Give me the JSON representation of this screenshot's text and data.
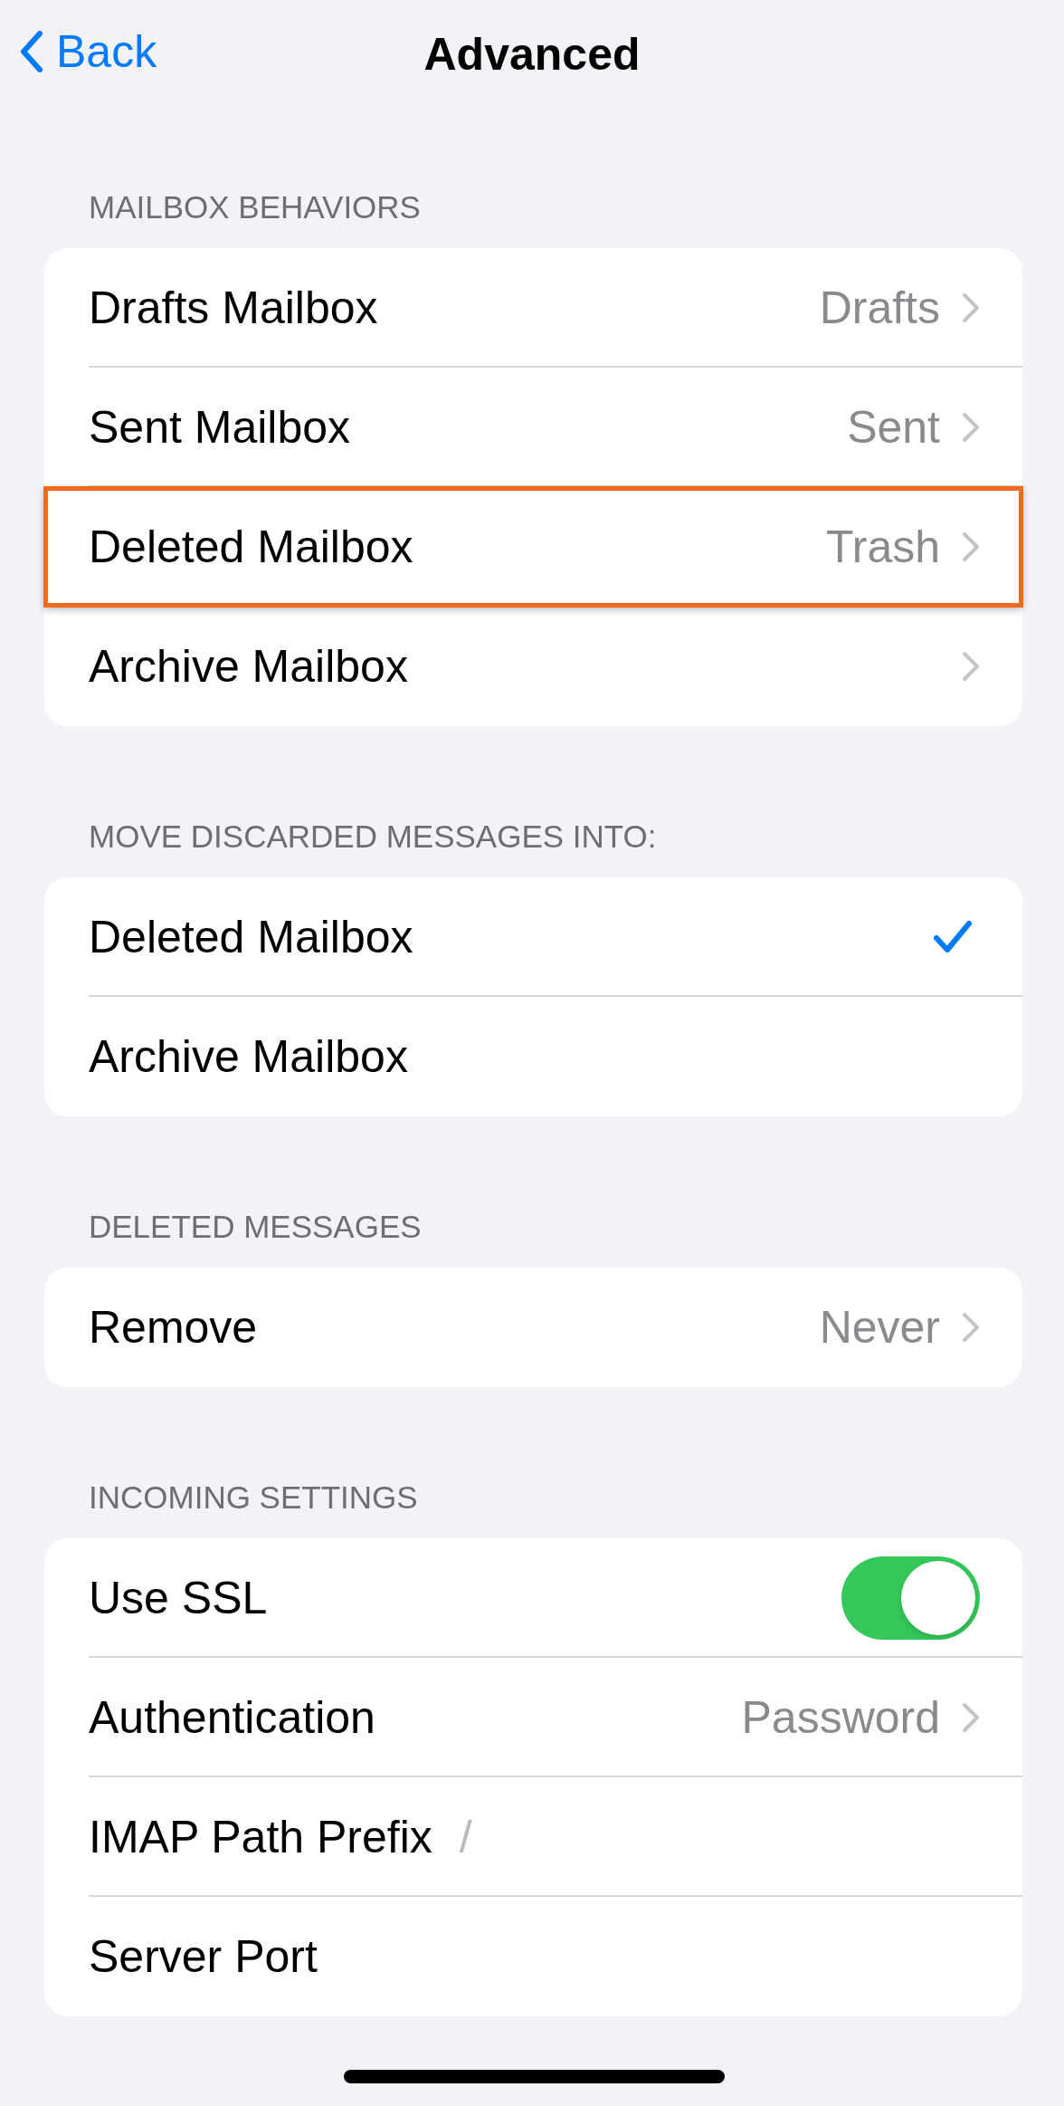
{
  "nav": {
    "back": "Back",
    "title": "Advanced"
  },
  "sections": [
    {
      "header": "MAILBOX BEHAVIORS",
      "rows": [
        {
          "kind": "link",
          "label": "Drafts Mailbox",
          "value": "Drafts",
          "highlighted": false
        },
        {
          "kind": "link",
          "label": "Sent Mailbox",
          "value": "Sent",
          "highlighted": false
        },
        {
          "kind": "link",
          "label": "Deleted Mailbox",
          "value": "Trash",
          "highlighted": true
        },
        {
          "kind": "link",
          "label": "Archive Mailbox",
          "highlighted": false
        }
      ]
    },
    {
      "header": "MOVE DISCARDED MESSAGES INTO:",
      "rows": [
        {
          "kind": "check",
          "label": "Deleted Mailbox",
          "selected": true
        },
        {
          "kind": "check",
          "label": "Archive Mailbox",
          "selected": false
        }
      ]
    },
    {
      "header": "DELETED MESSAGES",
      "rows": [
        {
          "kind": "link",
          "label": "Remove",
          "value": "Never",
          "highlighted": false
        }
      ]
    },
    {
      "header": "INCOMING SETTINGS",
      "rows": [
        {
          "kind": "toggle",
          "label": "Use SSL",
          "on": true
        },
        {
          "kind": "link",
          "label": "Authentication",
          "value": "Password",
          "highlighted": false
        },
        {
          "kind": "field",
          "label": "IMAP Path Prefix",
          "placeholder": "/"
        },
        {
          "kind": "field",
          "label": "Server Port"
        }
      ]
    }
  ]
}
